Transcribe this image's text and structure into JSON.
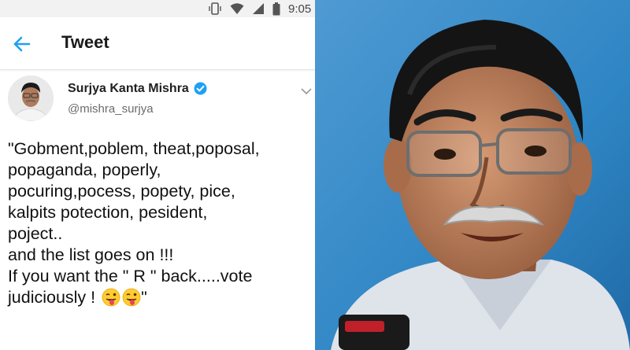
{
  "status_bar": {
    "time": "9:05",
    "icons": [
      "vibrate-icon",
      "wifi-icon",
      "signal-icon",
      "battery-icon"
    ]
  },
  "app_bar": {
    "title": "Tweet",
    "back_icon": "back-arrow-icon"
  },
  "tweet": {
    "display_name": "Surjya Kanta Mishra",
    "handle": "@mishra_surjya",
    "verified": true,
    "text_lines": [
      "\"Gobment,poblem, theat,poposal,",
      "popaganda, poperly,",
      "pocuring,pocess, popety, pice,",
      "kalpits  potection, pesident,",
      "poject..",
      "and the list goes on !!!",
      "If you want the \" R \" back.....vote",
      "judiciously !",
      "\""
    ],
    "emojis": [
      "winking-tongue-face-icon",
      "winking-tongue-face-icon"
    ]
  },
  "colors": {
    "accent_blue": "#1da1f2",
    "text": "#111111",
    "handle_gray": "#6b6b6b",
    "photo_background": "#2f86c4"
  }
}
